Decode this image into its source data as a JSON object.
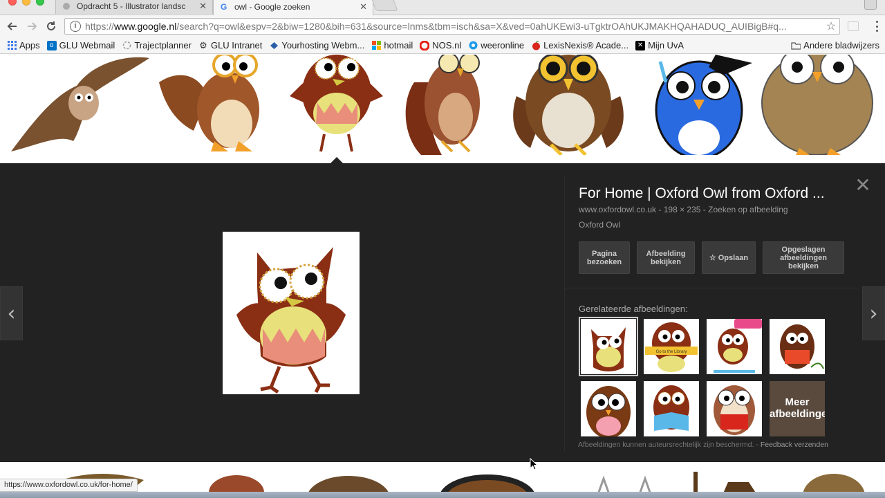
{
  "tabs": [
    {
      "title": "Opdracht 5 - Illustrator landsc",
      "active": false
    },
    {
      "title": "owl - Google zoeken",
      "active": true
    }
  ],
  "address": {
    "prefix": "https://",
    "host": "www.google.nl",
    "path": "/search?q=owl&espv=2&biw=1280&bih=631&source=lnms&tbm=isch&sa=X&ved=0ahUKEwi3-uTgktrOAhUKJMAKHQAHADUQ_AUIBigB#q..."
  },
  "bookmarks": [
    {
      "label": "Apps",
      "icon": "apps-grid-icon",
      "color": "#3b78e7"
    },
    {
      "label": "GLU Webmail",
      "icon": "outlook-icon",
      "color": "#0072c6"
    },
    {
      "label": "Trajectplanner",
      "icon": "loading-icon",
      "color": "#999999"
    },
    {
      "label": "GLU Intranet",
      "icon": "gear-icon",
      "color": "#333333"
    },
    {
      "label": "Yourhosting Webm...",
      "icon": "hosting-icon",
      "color": "#2a5ea8"
    },
    {
      "label": "hotmail",
      "icon": "windows-icon",
      "color": "#f25022"
    },
    {
      "label": "NOS.nl",
      "icon": "nos-icon",
      "color": "#e61e14"
    },
    {
      "label": "weeronline",
      "icon": "weather-icon",
      "color": "#1e9be9"
    },
    {
      "label": "LexisNexis® Acade...",
      "icon": "lexisnexis-icon",
      "color": "#d9261c"
    },
    {
      "label": "Mijn UvA",
      "icon": "uva-icon",
      "color": "#000000"
    }
  ],
  "bookmarks_other": "Andere bladwijzers",
  "preview": {
    "title": "For Home | Oxford Owl from Oxford ...",
    "domain": "www.oxfordowl.co.uk",
    "dimensions": "198 × 235",
    "search_by_image": "Zoeken op afbeelding",
    "source": "Oxford Owl",
    "buttons": {
      "visit": "Pagina bezoeken",
      "view_image": "Afbeelding bekijken",
      "save": "Opslaan",
      "view_saved": "Opgeslagen afbeeldingen bekijken"
    },
    "related_label": "Gerelateerde afbeeldingen:",
    "more_images": "Meer afbeeldingen",
    "copyright_note": "Afbeeldingen kunnen auteursrechtelijk zijn beschermd.",
    "feedback": "Feedback verzenden"
  },
  "status_url": "https://www.oxfordowl.co.uk/for-home/"
}
